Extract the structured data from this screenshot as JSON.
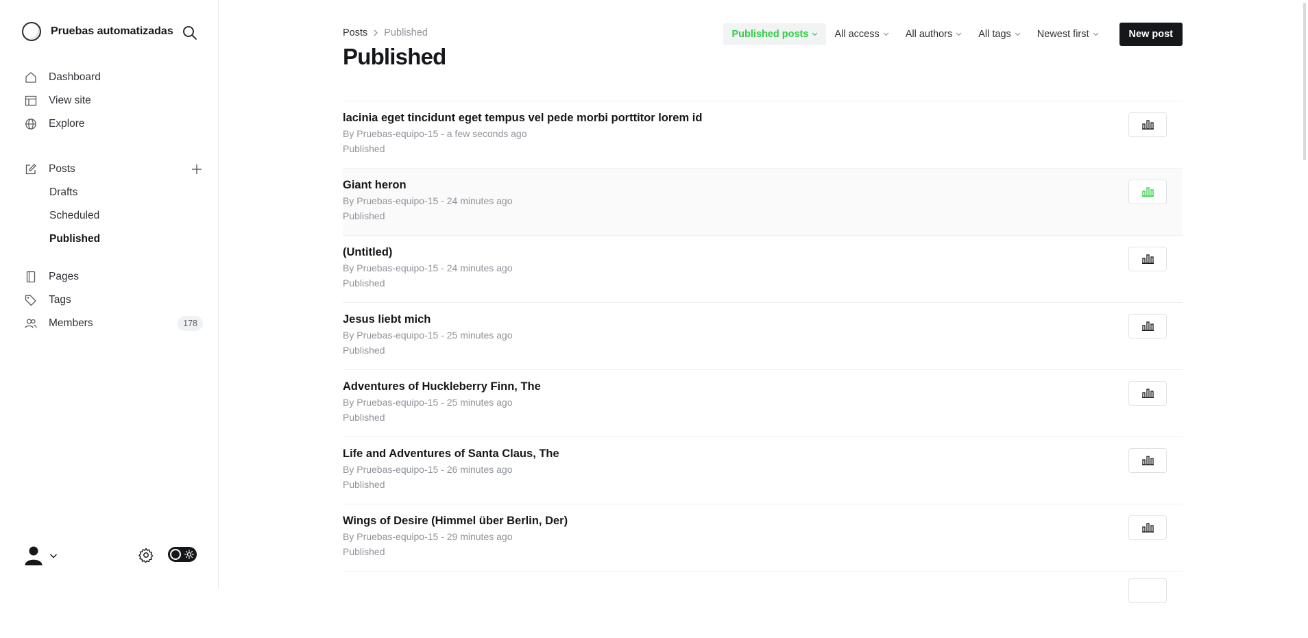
{
  "site": {
    "title": "Pruebas automatizadas",
    "logo_icon": "circle-logo-icon",
    "search_icon": "search-icon"
  },
  "sidebar": {
    "primary": [
      {
        "label": "Dashboard",
        "icon": "home-icon"
      },
      {
        "label": "View site",
        "icon": "layout-icon"
      },
      {
        "label": "Explore",
        "icon": "globe-icon"
      }
    ],
    "posts": {
      "label": "Posts",
      "icon": "edit-icon",
      "add_icon": "plus-icon"
    },
    "posts_sub": [
      {
        "label": "Drafts",
        "active": false
      },
      {
        "label": "Scheduled",
        "active": false
      },
      {
        "label": "Published",
        "active": true
      }
    ],
    "secondary": [
      {
        "label": "Pages",
        "icon": "page-icon"
      },
      {
        "label": "Tags",
        "icon": "tag-icon"
      },
      {
        "label": "Members",
        "icon": "members-icon",
        "count": "178"
      }
    ],
    "bottom": {
      "avatar_icon": "user-avatar-icon",
      "settings_icon": "gear-icon",
      "theme_toggle_icon": "sun-icon"
    }
  },
  "breadcrumb": {
    "parent": "Posts",
    "current": "Published"
  },
  "page_title": "Published",
  "filters": [
    {
      "label": "Published posts",
      "active": true
    },
    {
      "label": "All access",
      "active": false
    },
    {
      "label": "All authors",
      "active": false
    },
    {
      "label": "All tags",
      "active": false
    },
    {
      "label": "Newest first",
      "active": false
    }
  ],
  "new_post_label": "New post",
  "posts": [
    {
      "title": "lacinia eget tincidunt eget tempus vel pede morbi porttitor lorem id",
      "meta": "By Pruebas-equipo-15 - a few seconds ago",
      "status": "Published",
      "hover": false
    },
    {
      "title": "Giant heron",
      "meta": "By Pruebas-equipo-15 - 24 minutes ago",
      "status": "Published",
      "hover": true
    },
    {
      "title": "(Untitled)",
      "meta": "By Pruebas-equipo-15 - 24 minutes ago",
      "status": "Published",
      "hover": false
    },
    {
      "title": "Jesus liebt mich",
      "meta": "By Pruebas-equipo-15 - 25 minutes ago",
      "status": "Published",
      "hover": false
    },
    {
      "title": "Adventures of Huckleberry Finn, The",
      "meta": "By Pruebas-equipo-15 - 25 minutes ago",
      "status": "Published",
      "hover": false
    },
    {
      "title": "Life and Adventures of Santa Claus, The",
      "meta": "By Pruebas-equipo-15 - 26 minutes ago",
      "status": "Published",
      "hover": false
    },
    {
      "title": "Wings of Desire (Himmel über Berlin, Der)",
      "meta": "By Pruebas-equipo-15 - 29 minutes ago",
      "status": "Published",
      "hover": false
    }
  ],
  "colors": {
    "accent": "#30cf43",
    "text": "#15171a",
    "muted": "#8e9399",
    "border": "#e6e8eb",
    "button_dark": "#15171a"
  }
}
